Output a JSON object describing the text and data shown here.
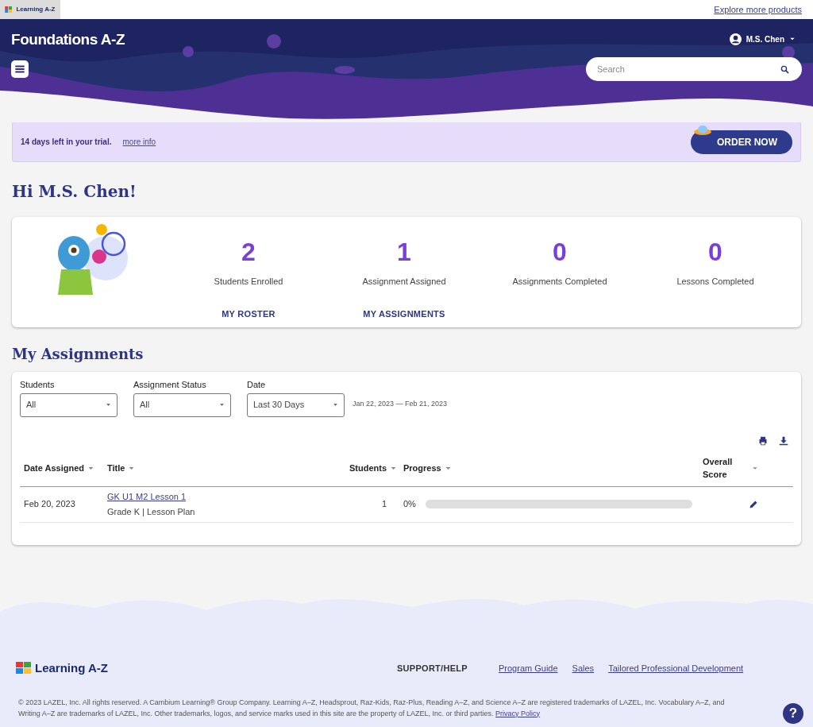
{
  "topbar": {
    "brand": "Learning A-Z",
    "link": "Explore more products"
  },
  "header": {
    "logo": "Foundations A-Z",
    "user": "M.S. Chen",
    "search": {
      "placeholder": "Search"
    }
  },
  "trial": {
    "message": "14 days left in your trial.",
    "link": "more info",
    "button": "ORDER NOW"
  },
  "greeting": "Hi M.S. Chen!",
  "stats": [
    {
      "value": "2",
      "label": "Students Enrolled",
      "action": "MY ROSTER"
    },
    {
      "value": "1",
      "label": "Assignment Assigned",
      "action": "MY ASSIGNMENTS"
    },
    {
      "value": "0",
      "label": "Assignments Completed"
    },
    {
      "value": "0",
      "label": "Lessons Completed"
    }
  ],
  "assignments": {
    "title": "My Assignments",
    "filters": [
      {
        "label": "Students",
        "value": "All"
      },
      {
        "label": "Assignment Status",
        "value": "All"
      },
      {
        "label": "Date",
        "value": "Last 30 Days"
      }
    ],
    "date_range": "Jan 22, 2023 — Feb 21, 2023",
    "columns": [
      "Date Assigned",
      "Title",
      "Students",
      "Progress",
      "Overall Score"
    ],
    "rows": [
      {
        "date": "Feb 20, 2023",
        "title": "GK U1 M2 Lesson 1",
        "subtitle": "Grade K | Lesson Plan",
        "students": "1",
        "progress": "0%",
        "level": 0
      }
    ]
  },
  "footer": {
    "brand": "Learning A-Z",
    "support": "SUPPORT/HELP",
    "links": [
      "Program Guide",
      "Sales",
      "Tailored Professional Development"
    ],
    "legal": "© 2023 LAZEL, Inc. All rights reserved. A Cambium Learning® Group Company. Learning A–Z, Headsprout, Raz-Kids, Raz-Plus, Reading A–Z, and Science A–Z are registered trademarks of LAZEL, Inc. Vocabulary A–Z, and Writing A–Z are trademarks of LAZEL, Inc. Other trademarks, logos, and service marks used in this site are the property of LAZEL, Inc. or third parties.",
    "privacy": "Privacy Policy",
    "help": "?"
  }
}
